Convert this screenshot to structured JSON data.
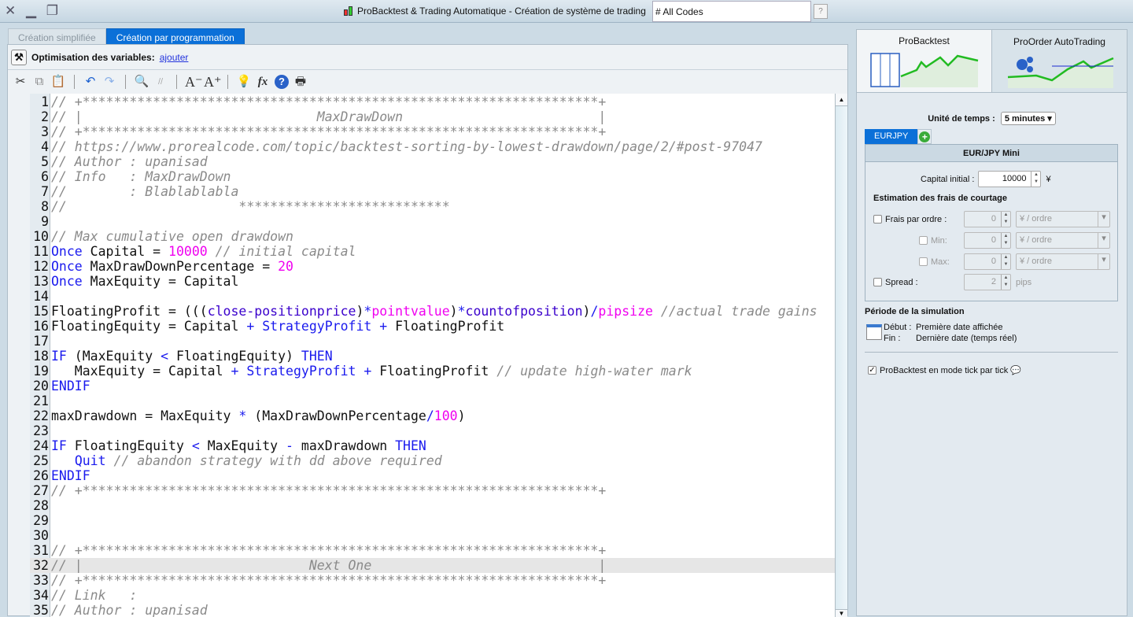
{
  "window": {
    "title": "ProBacktest & Trading Automatique - Création de système de trading",
    "search_value": "# All Codes",
    "controls": "✕ ▁ ❐"
  },
  "left_tabs": [
    {
      "label": "Création simplifiée"
    },
    {
      "label": "Création par programmation"
    }
  ],
  "optimisation": {
    "label": "Optimisation des variables:",
    "link": "ajouter"
  },
  "toolbar": [
    "cut-icon",
    "copy-icon",
    "paste-icon",
    "undo-icon",
    "redo-icon",
    "find-icon",
    "comment-icon",
    "font-decrease-icon",
    "font-increase-icon",
    "lightbulb-icon",
    "function-icon",
    "help-icon",
    "print-icon"
  ],
  "code": {
    "highlighted_line": 32,
    "lines": [
      [
        [
          "cm",
          "// +******************************************************************+"
        ]
      ],
      [
        [
          "cm",
          "// |                              MaxDrawDown                         |"
        ]
      ],
      [
        [
          "cm",
          "// +******************************************************************+"
        ]
      ],
      [
        [
          "cm",
          "// https://www.prorealcode.com/topic/backtest-sorting-by-lowest-drawdown/page/2/#post-97047"
        ]
      ],
      [
        [
          "cm",
          "// Author : upanisad"
        ]
      ],
      [
        [
          "cm",
          "// Info   : MaxDrawDown"
        ]
      ],
      [
        [
          "cm",
          "//        : Blablablabla"
        ]
      ],
      [
        [
          "cm",
          "//                      ***************************"
        ]
      ],
      [],
      [
        [
          "cm",
          "// Max cumulative open drawdown"
        ]
      ],
      [
        [
          "kw",
          "Once"
        ],
        [
          "tx",
          " Capital = "
        ],
        [
          "nm",
          "10000"
        ],
        [
          "tx",
          " "
        ],
        [
          "cm",
          "// initial capital"
        ]
      ],
      [
        [
          "kw",
          "Once"
        ],
        [
          "tx",
          " MaxDrawDownPercentage = "
        ],
        [
          "nm",
          "20"
        ]
      ],
      [
        [
          "kw",
          "Once"
        ],
        [
          "tx",
          " MaxEquity = Capital"
        ]
      ],
      [],
      [
        [
          "tx",
          "FloatingProfit = ((("
        ],
        [
          "fn",
          "close-positionprice"
        ],
        [
          "tx",
          ")"
        ],
        [
          "kw",
          "*"
        ],
        [
          "nm",
          "pointvalue"
        ],
        [
          "tx",
          ")"
        ],
        [
          "kw",
          "*"
        ],
        [
          "fn",
          "countofposition"
        ],
        [
          "tx",
          ")"
        ],
        [
          "kw",
          "/"
        ],
        [
          "nm",
          "pipsize"
        ],
        [
          "tx",
          " "
        ],
        [
          "cm",
          "//actual trade gains"
        ]
      ],
      [
        [
          "tx",
          "FloatingEquity = Capital "
        ],
        [
          "kw",
          "+"
        ],
        [
          "tx",
          " "
        ],
        [
          "kw",
          "StrategyProfit"
        ],
        [
          "tx",
          " "
        ],
        [
          "kw",
          "+"
        ],
        [
          "tx",
          " FloatingProfit"
        ]
      ],
      [],
      [
        [
          "kw",
          "IF"
        ],
        [
          "tx",
          " (MaxEquity "
        ],
        [
          "kw",
          "<"
        ],
        [
          "tx",
          " FloatingEquity) "
        ],
        [
          "kw",
          "THEN"
        ]
      ],
      [
        [
          "tx",
          "   MaxEquity = Capital "
        ],
        [
          "kw",
          "+"
        ],
        [
          "tx",
          " "
        ],
        [
          "kw",
          "StrategyProfit"
        ],
        [
          "tx",
          " "
        ],
        [
          "kw",
          "+"
        ],
        [
          "tx",
          " FloatingProfit "
        ],
        [
          "cm",
          "// update high-water mark"
        ]
      ],
      [
        [
          "kw",
          "ENDIF"
        ]
      ],
      [],
      [
        [
          "tx",
          "maxDrawdown = MaxEquity "
        ],
        [
          "kw",
          "*"
        ],
        [
          "tx",
          " (MaxDrawDownPercentage"
        ],
        [
          "kw",
          "/"
        ],
        [
          "nm",
          "100"
        ],
        [
          "tx",
          ")"
        ]
      ],
      [],
      [
        [
          "kw",
          "IF"
        ],
        [
          "tx",
          " FloatingEquity "
        ],
        [
          "kw",
          "<"
        ],
        [
          "tx",
          " MaxEquity "
        ],
        [
          "kw",
          "-"
        ],
        [
          "tx",
          " maxDrawdown "
        ],
        [
          "kw",
          "THEN"
        ]
      ],
      [
        [
          "tx",
          "   "
        ],
        [
          "kw",
          "Quit"
        ],
        [
          "tx",
          " "
        ],
        [
          "cm",
          "// abandon strategy with dd above required"
        ]
      ],
      [
        [
          "kw",
          "ENDIF"
        ]
      ],
      [
        [
          "cm",
          "// +******************************************************************+"
        ]
      ],
      [],
      [],
      [],
      [
        [
          "cm",
          "// +******************************************************************+"
        ]
      ],
      [
        [
          "cm",
          "// |                             Next One                             |"
        ]
      ],
      [
        [
          "cm",
          "// +******************************************************************+"
        ]
      ],
      [
        [
          "cm",
          "// Link   :"
        ]
      ],
      [
        [
          "cm",
          "// Author : upanisad"
        ]
      ]
    ]
  },
  "right": {
    "tabs": [
      {
        "label": "ProBacktest"
      },
      {
        "label": "ProOrder AutoTrading"
      }
    ],
    "unit_label": "Unité de temps :",
    "unit_value": "5 minutes",
    "instrument_tab": "EURJPY",
    "box_title": "EUR/JPY Mini",
    "capital_label": "Capital initial :",
    "capital_value": "10000",
    "currency": "¥",
    "fees_title": "Estimation des frais de courtage",
    "fees": [
      {
        "label": "Frais par ordre :",
        "value": "0",
        "unit": "¥ / ordre"
      },
      {
        "label": "Min:",
        "value": "0",
        "unit": "¥ / ordre"
      },
      {
        "label": "Max:",
        "value": "0",
        "unit": "¥ / ordre"
      }
    ],
    "spread": {
      "label": "Spread :",
      "value": "2",
      "unit": "pips"
    },
    "period_title": "Période de la simulation",
    "start_label": "Début :",
    "start_value": "Première date affichée",
    "end_label": "Fin :",
    "end_value": "Dernière date (temps réel)",
    "tick_label": "ProBacktest en mode tick par tick",
    "tick_checked": true
  }
}
